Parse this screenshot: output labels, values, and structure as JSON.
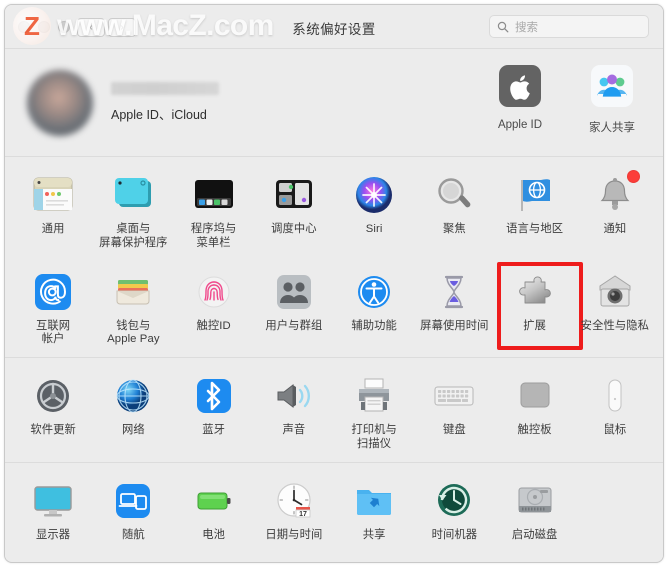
{
  "window": {
    "title": "系统偏好设置",
    "traffic_lights": [
      "close",
      "minimize",
      "zoom"
    ],
    "nav_back": "‹",
    "nav_forward": "›"
  },
  "watermark": {
    "logo_letter": "Z",
    "text": "www.MacZ.com"
  },
  "search": {
    "placeholder": "搜索",
    "value": "",
    "icon": "search-icon"
  },
  "account": {
    "name": "",
    "subtitle": "Apple ID、iCloud",
    "avatar_icon": "user-avatar",
    "items": [
      {
        "label": "Apple ID",
        "icon": "apple-logo-icon"
      },
      {
        "label": "家人共享",
        "icon": "family-sharing-icon"
      }
    ]
  },
  "sections": [
    {
      "name": "personal",
      "rows": [
        [
          {
            "label": "通用",
            "icon": "general-icon"
          },
          {
            "label": "桌面与\n屏幕保护程序",
            "icon": "desktop-screensaver-icon"
          },
          {
            "label": "程序坞与\n菜单栏",
            "icon": "dock-menubar-icon"
          },
          {
            "label": "调度中心",
            "icon": "mission-control-icon"
          },
          {
            "label": "Siri",
            "icon": "siri-icon"
          },
          {
            "label": "聚焦",
            "icon": "spotlight-icon"
          },
          {
            "label": "语言与地区",
            "icon": "language-region-icon"
          },
          {
            "label": "通知",
            "icon": "notifications-icon",
            "badge": true
          }
        ],
        [
          {
            "label": "互联网\n帐户",
            "icon": "internet-accounts-icon"
          },
          {
            "label": "钱包与\nApple Pay",
            "icon": "wallet-applepay-icon"
          },
          {
            "label": "触控ID",
            "icon": "touch-id-icon"
          },
          {
            "label": "用户与群组",
            "icon": "users-groups-icon"
          },
          {
            "label": "辅助功能",
            "icon": "accessibility-icon"
          },
          {
            "label": "屏幕使用时间",
            "icon": "screen-time-icon"
          },
          {
            "label": "扩展",
            "icon": "extensions-icon",
            "highlighted": true
          },
          {
            "label": "安全性与隐私",
            "icon": "security-privacy-icon"
          }
        ]
      ]
    },
    {
      "name": "hardware",
      "rows": [
        [
          {
            "label": "软件更新",
            "icon": "software-update-icon"
          },
          {
            "label": "网络",
            "icon": "network-icon"
          },
          {
            "label": "蓝牙",
            "icon": "bluetooth-icon"
          },
          {
            "label": "声音",
            "icon": "sound-icon"
          },
          {
            "label": "打印机与\n扫描仪",
            "icon": "printers-scanners-icon"
          },
          {
            "label": "键盘",
            "icon": "keyboard-icon"
          },
          {
            "label": "触控板",
            "icon": "trackpad-icon"
          },
          {
            "label": "鼠标",
            "icon": "mouse-icon"
          }
        ]
      ]
    },
    {
      "name": "system",
      "rows": [
        [
          {
            "label": "显示器",
            "icon": "displays-icon"
          },
          {
            "label": "随航",
            "icon": "sidecar-icon"
          },
          {
            "label": "电池",
            "icon": "battery-icon"
          },
          {
            "label": "日期与时间",
            "icon": "date-time-icon",
            "clock_day": "17"
          },
          {
            "label": "共享",
            "icon": "sharing-icon"
          },
          {
            "label": "时间机器",
            "icon": "time-machine-icon"
          },
          {
            "label": "启动磁盘",
            "icon": "startup-disk-icon"
          }
        ]
      ]
    }
  ],
  "colors": {
    "highlight": "#ee1c1c",
    "window_bg": "#ececec",
    "badge": "#fc3d39",
    "accent_blue": "#1d8bf0"
  }
}
